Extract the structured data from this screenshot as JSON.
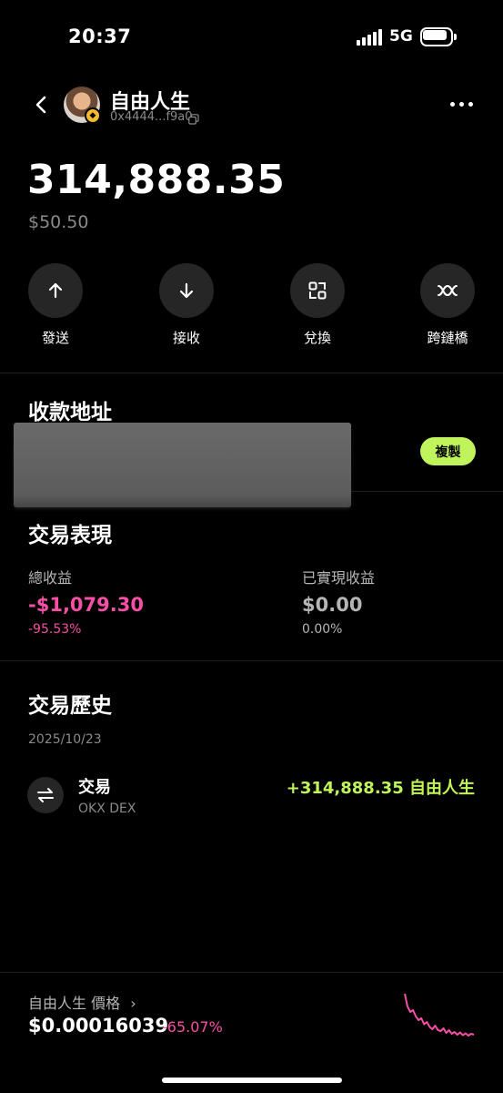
{
  "status_bar": {
    "time": "20:37",
    "network": "5G"
  },
  "header": {
    "token_name": "自由人生",
    "address": "0x4444...f9a0"
  },
  "balance": {
    "amount": "314,888.35",
    "usd_value": "$50.50"
  },
  "actions": [
    {
      "label": "發送",
      "icon": "arrow-up-icon"
    },
    {
      "label": "接收",
      "icon": "arrow-down-icon"
    },
    {
      "label": "兌換",
      "icon": "swap-grid-icon"
    },
    {
      "label": "跨鏈橋",
      "icon": "bridge-icon"
    }
  ],
  "receive": {
    "title": "收款地址",
    "copy_label": "複製"
  },
  "performance": {
    "title": "交易表現",
    "total_label": "總收益",
    "total_value": "-$1,079.30",
    "total_pct": "-95.53%",
    "realized_label": "已實現收益",
    "realized_value": "$0.00",
    "realized_pct": "0.00%"
  },
  "history": {
    "title": "交易歷史",
    "date": "2025/10/23",
    "items": [
      {
        "title": "交易",
        "source": "OKX DEX",
        "amount": "+314,888.35 自由人生"
      }
    ]
  },
  "price_bar": {
    "label": "自由人生 價格",
    "chevron": "›",
    "price": "$0.00016039",
    "change": "-65.07%",
    "sparkline": [
      1.0,
      0.72,
      0.6,
      0.64,
      0.5,
      0.42,
      0.46,
      0.33,
      0.38,
      0.27,
      0.22,
      0.3,
      0.2,
      0.18,
      0.24,
      0.14,
      0.2,
      0.12,
      0.16,
      0.1,
      0.15,
      0.09,
      0.13,
      0.08,
      0.12,
      0.1
    ],
    "colors": {
      "negative": "#f74fa6",
      "positive": "#bff55a"
    }
  }
}
